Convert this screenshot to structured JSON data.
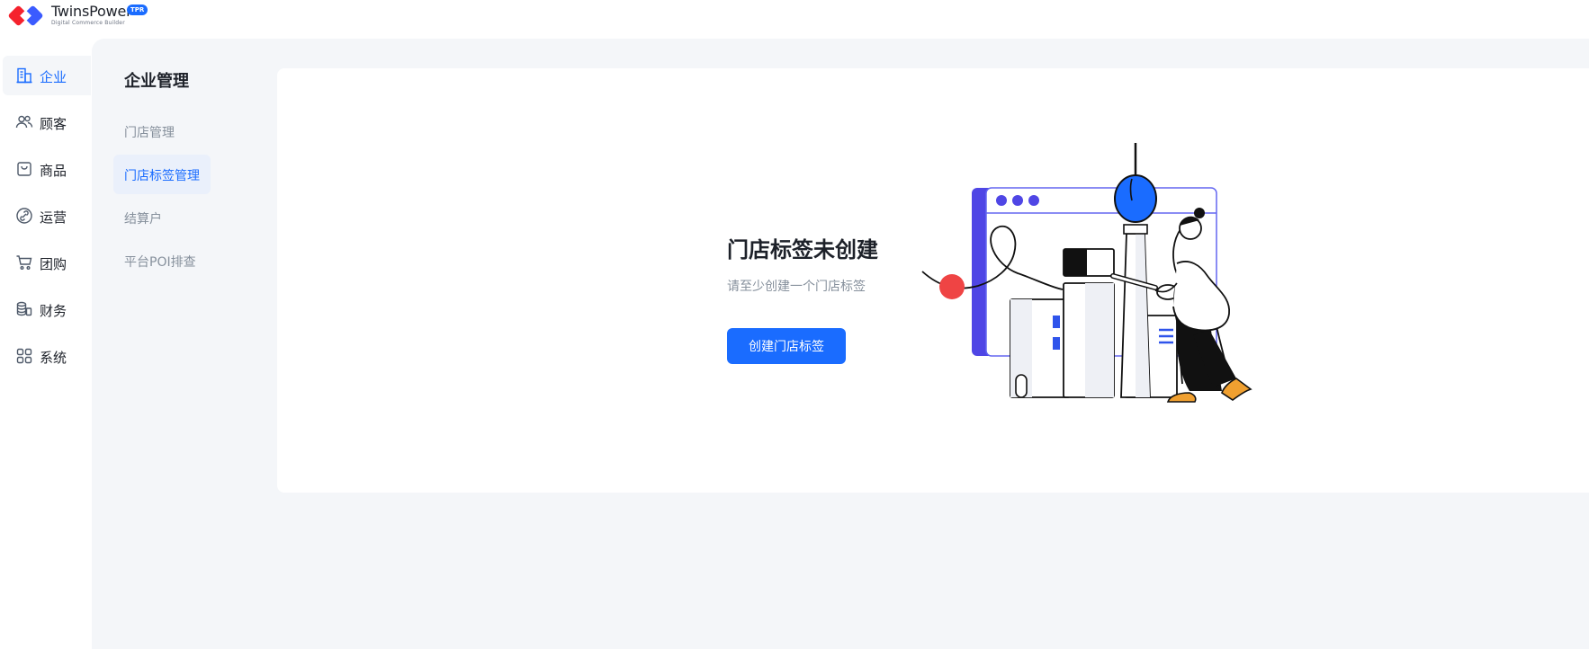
{
  "brand": {
    "name": "TwinsPower",
    "badge": "TPR",
    "tagline": "Digital Commerce Builder"
  },
  "colors": {
    "accent": "#1a6cff",
    "workspace_bg": "#f4f6f9",
    "logo_red": "#f5222d",
    "logo_blue": "#3b5bff",
    "illustration_purple": "#4f46e5"
  },
  "nav": {
    "items": [
      {
        "label": "企业",
        "icon": "building-icon",
        "active": true
      },
      {
        "label": "顾客",
        "icon": "users-icon",
        "active": false
      },
      {
        "label": "商品",
        "icon": "bag-icon",
        "active": false
      },
      {
        "label": "运营",
        "icon": "link-icon",
        "active": false
      },
      {
        "label": "团购",
        "icon": "cart-icon",
        "active": false
      },
      {
        "label": "财务",
        "icon": "coins-icon",
        "active": false
      },
      {
        "label": "系统",
        "icon": "grid-icon",
        "active": false
      }
    ]
  },
  "subnav": {
    "title": "企业管理",
    "items": [
      {
        "label": "门店管理",
        "active": false
      },
      {
        "label": "门店标签管理",
        "active": true
      },
      {
        "label": "结算户",
        "active": false
      },
      {
        "label": "平台POI排查",
        "active": false
      }
    ]
  },
  "empty_state": {
    "title": "门店标签未创建",
    "description": "请至少创建一个门店标签",
    "button_label": "创建门店标签",
    "illustration": "city-tower-with-person-illustration"
  }
}
